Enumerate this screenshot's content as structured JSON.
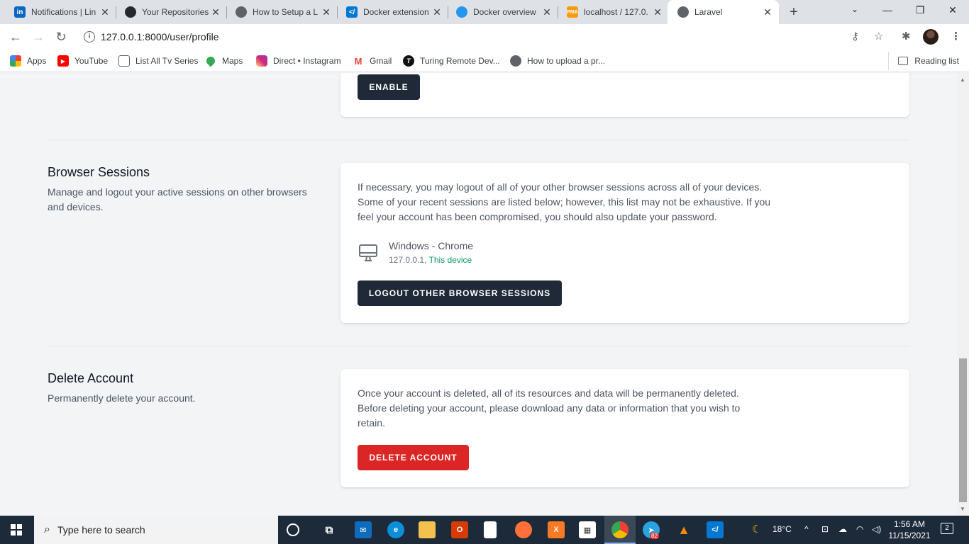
{
  "browser": {
    "tabs": [
      {
        "title": "Notifications | Lin",
        "icon": "linkedin-icon",
        "color": "#0a66c2"
      },
      {
        "title": "Your Repositories",
        "icon": "github-icon",
        "color": "#24292f"
      },
      {
        "title": "How to Setup a L",
        "icon": "globe-icon",
        "color": "#5f6368"
      },
      {
        "title": "Docker extension",
        "icon": "vscode-icon",
        "color": "#0078d4"
      },
      {
        "title": "Docker overview",
        "icon": "docker-icon",
        "color": "#2496ed"
      },
      {
        "title": "localhost / 127.0.",
        "icon": "phpmyadmin-icon",
        "color": "#f89c0e"
      },
      {
        "title": "Laravel",
        "icon": "globe-icon",
        "color": "#5f6368"
      }
    ],
    "url": "127.0.0.1:8000/user/profile",
    "bookmarks": [
      {
        "label": "Apps",
        "icon": "apps-grid-icon",
        "color": "#ea4335"
      },
      {
        "label": "YouTube",
        "icon": "youtube-icon",
        "color": "#ff0000"
      },
      {
        "label": "List All Tv Series",
        "icon": "tv-icon",
        "color": "#5f6368"
      },
      {
        "label": "Maps",
        "icon": "maps-icon",
        "color": "#34a853"
      },
      {
        "label": "Direct • Instagram",
        "icon": "instagram-icon",
        "color": "#d6249f"
      },
      {
        "label": "Gmail",
        "icon": "gmail-icon",
        "color": "#ea4335"
      },
      {
        "label": "Turing Remote Dev...",
        "icon": "turing-icon",
        "color": "#111111"
      },
      {
        "label": "How to upload a pr...",
        "icon": "globe-icon",
        "color": "#5f6368"
      }
    ],
    "reading_list": "Reading list"
  },
  "page": {
    "two_factor": {
      "enable_button": "Enable"
    },
    "browser_sessions": {
      "title": "Browser Sessions",
      "description": "Manage and logout your active sessions on other browsers and devices.",
      "info": "If necessary, you may logout of all of your other browser sessions across all of your devices. Some of your recent sessions are listed below; however, this list may not be exhaustive. If you feel your account has been compromised, you should also update your password.",
      "session": {
        "device": "Windows - Chrome",
        "ip": "127.0.0.1,",
        "this_device": "This device"
      },
      "logout_button": "Logout Other Browser Sessions"
    },
    "delete_account": {
      "title": "Delete Account",
      "description": "Permanently delete your account.",
      "info": "Once your account is deleted, all of its resources and data will be permanently deleted. Before deleting your account, please download any data or information that you wish to retain.",
      "delete_button": "Delete Account"
    }
  },
  "colors": {
    "dark_button": "#1f2937",
    "danger": "#dc2626",
    "this_device": "#059669"
  },
  "taskbar": {
    "search_placeholder": "Type here to search",
    "weather": "18°C",
    "time": "1:56 AM",
    "date": "11/15/2021",
    "telegram_badge": "82",
    "notifications": "2"
  }
}
